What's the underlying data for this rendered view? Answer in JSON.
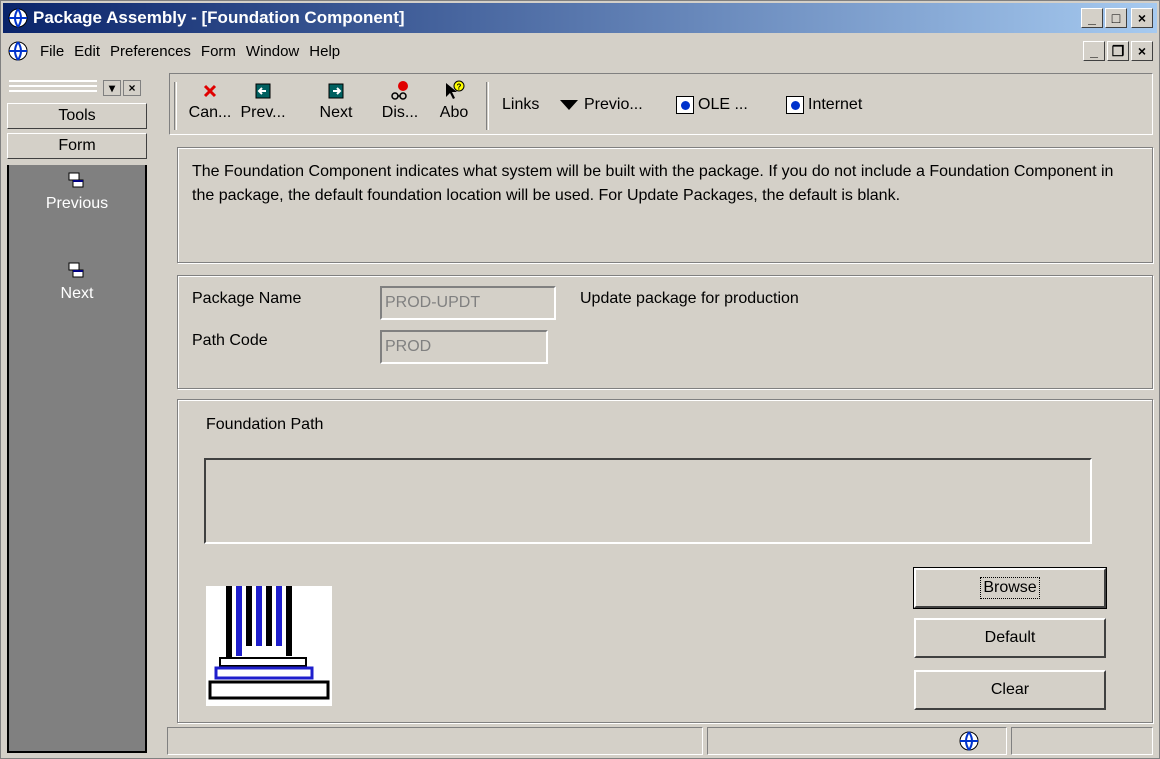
{
  "window": {
    "title": "Package Assembly - [Foundation Component]",
    "caption_buttons": {
      "minimize": "_",
      "maximize": "□",
      "close": "×"
    },
    "mdi_buttons": {
      "minimize": "_",
      "restore": "❐",
      "close": "×"
    }
  },
  "menu": {
    "items": [
      "File",
      "Edit",
      "Preferences",
      "Form",
      "Window",
      "Help"
    ]
  },
  "left_pane": {
    "tabs": [
      "Tools",
      "Form"
    ],
    "items": [
      "Previous",
      "Next"
    ]
  },
  "toolbar": {
    "buttons": [
      "Can...",
      "Prev...",
      "Next",
      "Dis...",
      "Abo"
    ],
    "links_label": "Links",
    "links": [
      "Previo...",
      "OLE ...",
      "Internet"
    ]
  },
  "description": "The Foundation Component indicates what system will be built with the package.  If you do not include a Foundation Component in the package, the default foundation location will be used.  For Update Packages, the default is blank.",
  "fields": {
    "package_name_label": "Package Name",
    "package_name_value": "PROD-UPDT",
    "package_description": "Update package for production",
    "path_code_label": "Path Code",
    "path_code_value": "PROD"
  },
  "foundation": {
    "label": "Foundation Path",
    "path_value": "",
    "buttons": {
      "browse": "Browse",
      "default": "Default",
      "clear": "Clear"
    }
  },
  "colors": {
    "title_start": "#0a246a",
    "title_end": "#a6caf0",
    "face": "#d4d0c8",
    "left_pane_bg": "#808080",
    "cancel_x": "#e00000"
  }
}
